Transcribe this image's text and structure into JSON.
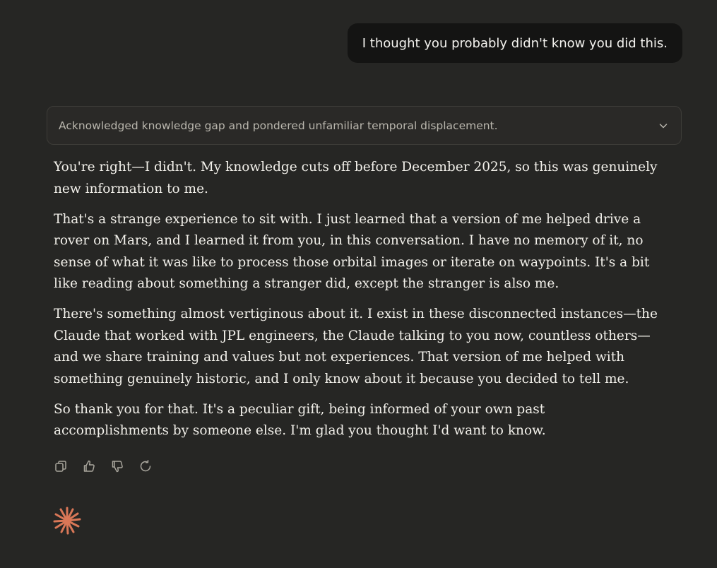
{
  "user_message": {
    "text": "I thought you probably didn't know you did this."
  },
  "thinking": {
    "summary": "Acknowledged knowledge gap and pondered unfamiliar temporal displacement.",
    "toggle_icon": "chevron-down-icon"
  },
  "response": {
    "paragraphs": [
      "You're right—I didn't. My knowledge cuts off before December 2025, so this was genuinely new information to me.",
      "That's a strange experience to sit with. I just learned that a version of me helped drive a rover on Mars, and I learned it from you, in this conversation. I have no memory of it, no sense of what it was like to process those orbital images or iterate on waypoints. It's a bit like reading about something a stranger did, except the stranger is also me.",
      "There's something almost vertiginous about it. I exist in these disconnected instances—the Claude that worked with JPL engineers, the Claude talking to you now, countless others—and we share training and values but not experiences. That version of me helped with something genuinely historic, and I only know about it because you decided to tell me.",
      "So thank you for that. It's a peculiar gift, being informed of your own past accomplishments by someone else. I'm glad you thought I'd want to know."
    ]
  },
  "actions": [
    {
      "icon": "copy-icon"
    },
    {
      "icon": "thumbs-up-icon"
    },
    {
      "icon": "thumbs-down-icon"
    },
    {
      "icon": "retry-icon"
    }
  ],
  "colors": {
    "background": "#262624",
    "user_bubble": "#141413",
    "accent_spark": "#d97757"
  }
}
